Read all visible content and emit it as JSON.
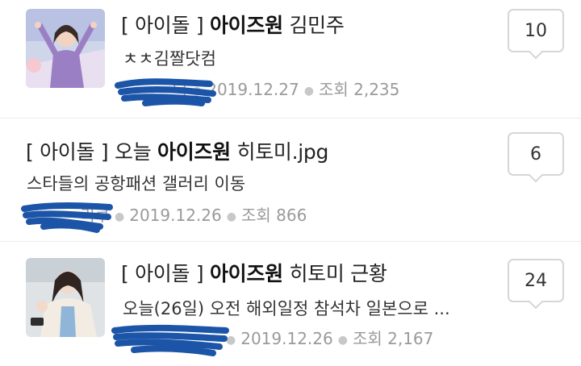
{
  "posts": [
    {
      "category_open": "[ 아이돌 ]",
      "keyword": "아이즈원",
      "title_rest": "김민주",
      "subtitle": "ㅊㅊ김짤닷컴",
      "author_partial": "더",
      "date": "2019.12.27",
      "views_label": "조회",
      "views": "2,235",
      "comments": "10",
      "thumbnail": "photo-thumbnail"
    },
    {
      "category_open": "[ 아이돌 ]",
      "title_prefix": "오늘",
      "keyword": "아이즈원",
      "title_rest": "히토미.jpg",
      "subtitle": "스타들의 공항패션 갤러리 이동",
      "author_partial": "리쿠",
      "date": "2019.12.26",
      "views_label": "조회",
      "views": "866",
      "comments": "6"
    },
    {
      "category_open": "[ 아이돌 ]",
      "keyword": "아이즈원",
      "title_rest": "히토미 근황",
      "subtitle": "오늘(26일) 오전 해외일정 참석차 일본으로 ...",
      "author_partial": "",
      "date": "2019.12.26",
      "views_label": "조회",
      "views": "2,167",
      "comments": "24",
      "thumbnail": "photo-thumbnail"
    }
  ],
  "colors": {
    "redaction": "#1c55a8",
    "meta_text": "#9a9a9a",
    "divider": "#ececec"
  }
}
